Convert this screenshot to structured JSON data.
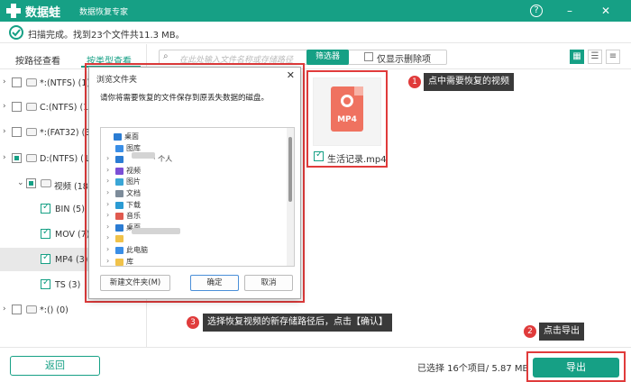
{
  "app": {
    "logo_text": "数据蛙",
    "subtitle": "数据恢复专家",
    "help_label": "?",
    "minimize_label": "–",
    "close_label": "✕"
  },
  "status": {
    "text": "扫描完成。找到23个文件共11.3 MB。"
  },
  "sidebar": {
    "tabs": [
      {
        "label": "按路径查看",
        "active": false
      },
      {
        "label": "按类型查看",
        "active": true
      }
    ],
    "tree": [
      {
        "label": "*:(NTFS) (1)",
        "chevron": "›",
        "checkbox": "none",
        "selected": false
      },
      {
        "label": "C:(NTFS) (1)",
        "chevron": "›",
        "checkbox": "none",
        "selected": false
      },
      {
        "label": "*:(FAT32) (3)",
        "chevron": "›",
        "checkbox": "none",
        "selected": false
      },
      {
        "label": "D:(NTFS) (18)",
        "chevron": "›",
        "checkbox": "partial",
        "selected": false
      },
      {
        "label": "视频 (18)",
        "chevron": "⌄",
        "checkbox": "partial",
        "selected": false
      },
      {
        "label": "BIN (5)",
        "chevron": "",
        "checkbox": "checked",
        "selected": false
      },
      {
        "label": "MOV (7)",
        "chevron": "",
        "checkbox": "checked",
        "selected": false
      },
      {
        "label": "MP4 (3)",
        "chevron": "",
        "checkbox": "checked",
        "selected": true
      },
      {
        "label": "TS (3)",
        "chevron": "",
        "checkbox": "checked",
        "selected": false
      },
      {
        "label": "*:() (0)",
        "chevron": "›",
        "checkbox": "none",
        "selected": false
      }
    ]
  },
  "toolbar": {
    "search_placeholder": "在此处输入文件名称或存储路径",
    "filter_label": "筛选器",
    "only_deleted_label": "仅显示删除项",
    "view_icons": [
      "grid-view-icon",
      "list-view-icon",
      "detail-view-icon"
    ]
  },
  "file": {
    "icon_label": "MP4",
    "name": "生活记录.mp4",
    "checked": true
  },
  "steps": {
    "step1": {
      "number": "1",
      "text": "点中需要恢复的视频"
    },
    "step2": {
      "number": "2",
      "text": "点击导出"
    },
    "step3": {
      "number": "3",
      "text": "选择恢复视频的新存储路径后，点击【确认】"
    }
  },
  "dialog": {
    "title": "浏览文件夹",
    "message": "请你将需要恢复的文件保存到原丢失数据的磁盘。",
    "folders": [
      {
        "label": "桌面",
        "chevron": "",
        "icon": "desktop",
        "indent": 0
      },
      {
        "label": "图库",
        "chevron": "",
        "icon": "gallery",
        "indent": 1
      },
      {
        "label": "· 个人",
        "chevron": "›",
        "icon": "cloud",
        "indent": 1
      },
      {
        "label": "视频",
        "chevron": "›",
        "icon": "video",
        "indent": 1
      },
      {
        "label": "图片",
        "chevron": "›",
        "icon": "picture",
        "indent": 1
      },
      {
        "label": "文档",
        "chevron": "›",
        "icon": "document",
        "indent": 1
      },
      {
        "label": "下载",
        "chevron": "›",
        "icon": "download",
        "indent": 1
      },
      {
        "label": "音乐",
        "chevron": "›",
        "icon": "music",
        "indent": 1
      },
      {
        "label": "桌面",
        "chevron": "›",
        "icon": "desktop",
        "indent": 1
      },
      {
        "label": "",
        "chevron": "›",
        "icon": "folder",
        "indent": 1
      },
      {
        "label": "此电脑",
        "chevron": "›",
        "icon": "computer",
        "indent": 1
      },
      {
        "label": "库",
        "chevron": "›",
        "icon": "library",
        "indent": 1
      }
    ],
    "new_folder_label": "新建文件夹(M)",
    "ok_label": "确定",
    "cancel_label": "取消",
    "close_label": "✕"
  },
  "footer": {
    "back_label": "返回",
    "selection_info": "已选择 16个项目/ 5.87 MB",
    "export_label": "导出"
  },
  "colors": {
    "brand": "#16a085",
    "highlight": "#e03b3b",
    "callout_bg": "#3a3a3a",
    "file_icon": "#ef7260"
  }
}
